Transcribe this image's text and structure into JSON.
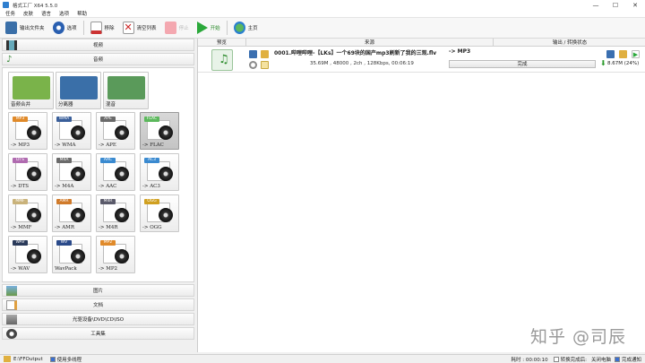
{
  "window": {
    "title": "格式工厂 X64 5.5.0",
    "minimize": "—",
    "maximize": "☐",
    "close": "✕"
  },
  "menu": [
    "任务",
    "皮肤",
    "语言",
    "选项",
    "帮助"
  ],
  "toolbar": {
    "output_folder": "输出文件夹",
    "options": "选项",
    "remove": "移除",
    "clear": "清空列表",
    "stop": "停止",
    "start": "开始",
    "home": "主页"
  },
  "sidebar": {
    "video": "视频",
    "audio": "音频",
    "image": "图片",
    "document": "文档",
    "disc": "光驱设备\\DVD\\CD\\ISO",
    "tools": "工具集"
  },
  "audio_tiles": [
    {
      "label": "音频合并",
      "fmt": ""
    },
    {
      "label": "分离器",
      "fmt": ""
    },
    {
      "label": "混音",
      "fmt": ""
    },
    {
      "label": "-> MP3",
      "fmt": "MP3"
    },
    {
      "label": "-> WMA",
      "fmt": "WMA"
    },
    {
      "label": "-> APE",
      "fmt": "APE"
    },
    {
      "label": "-> FLAC",
      "fmt": "FLAC"
    },
    {
      "label": "-> DTS",
      "fmt": "DTS"
    },
    {
      "label": "-> M4A",
      "fmt": "M4A"
    },
    {
      "label": "-> AAC",
      "fmt": "AAC"
    },
    {
      "label": "-> AC3",
      "fmt": "AC3"
    },
    {
      "label": "-> MMF",
      "fmt": "MMF"
    },
    {
      "label": "-> AMR",
      "fmt": "AMR"
    },
    {
      "label": "-> M4R",
      "fmt": "M4R"
    },
    {
      "label": "-> OGG",
      "fmt": "OGG"
    },
    {
      "label": "-> WAV",
      "fmt": "WAV"
    },
    {
      "label": "WavPack",
      "fmt": "WV"
    },
    {
      "label": "-> MP2",
      "fmt": "MP2"
    }
  ],
  "table": {
    "col_preview": "预览",
    "col_source": "来源",
    "col_output": "输出 / 转换状态"
  },
  "task": {
    "name": "0001.哔哩哔哩-【LKs】一个69块的国产mp3刷新了我的三观.flv",
    "info": "35.69M , 48000 , 2ch , 128Kbps, 00:06:19",
    "output": "-> MP3",
    "status": "完成",
    "size": "8.67M",
    "ratio": "(24%)"
  },
  "statusbar": {
    "path": "E:\\FFOutput",
    "multithread": "使用多线程",
    "elapsed": "耗时 : 00:00:10",
    "after": "转换完成后:",
    "shutdown": "关闭电脑",
    "notify": "完成通知"
  },
  "watermark": "知乎 @司辰",
  "colors": {
    "mp3": "#e08a2a",
    "wma": "#3a5f9a",
    "ape": "#6a6a6a",
    "flac": "#5cb85c",
    "dts": "#b06bb0",
    "m4a": "#6a6a6a",
    "aac": "#3a8ad0",
    "ac3": "#3a8ad0",
    "mmf": "#c9b27a",
    "amr": "#d07a2a",
    "m4r": "#5a5a6a",
    "ogg": "#d0a020",
    "wav": "#2a3a5a",
    "wv": "#2a4a8a",
    "mp2": "#e08a2a"
  }
}
